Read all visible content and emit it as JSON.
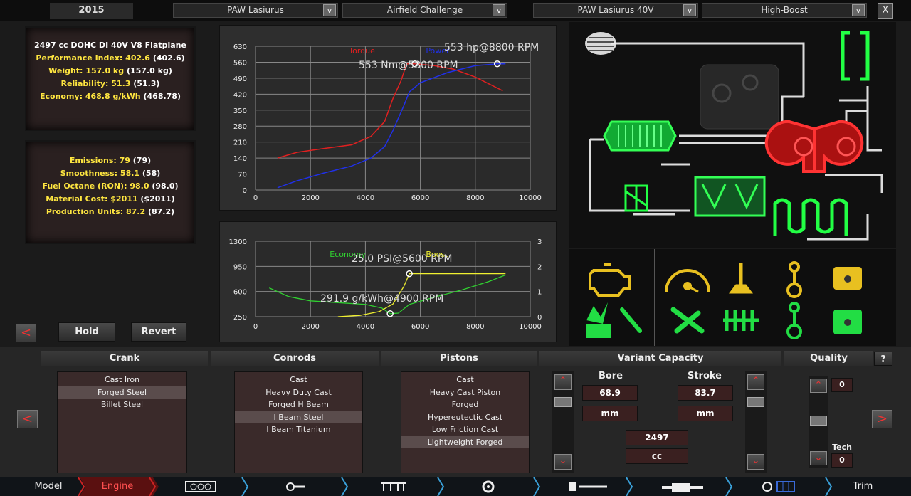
{
  "top": {
    "year": "2015",
    "model": "PAW Lasiurus",
    "challenge": "Airfield Challenge",
    "engine": "PAW Lasiurus 40V",
    "variant": "High-Boost",
    "dropdown_glyph": "v",
    "close_glyph": "X"
  },
  "stats1": {
    "engine_name": "2497 cc DOHC DI 40V V8 Flatplane",
    "lines": [
      {
        "label": "Performance Index:",
        "value": "402.6",
        "prev": "(402.6)"
      },
      {
        "label": "Weight:",
        "value": "157.0 kg",
        "prev": "(157.0 kg)"
      },
      {
        "label": "Reliability:",
        "value": "51.3",
        "prev": "(51.3)"
      },
      {
        "label": "Economy:",
        "value": "468.8 g/kWh",
        "prev": "(468.78)"
      }
    ]
  },
  "stats2": {
    "lines": [
      {
        "label": "Emissions:",
        "value": "79",
        "prev": "(79)"
      },
      {
        "label": "Smoothness:",
        "value": "58.1",
        "prev": "(58)"
      },
      {
        "label": "Fuel Octane (RON):",
        "value": "98.0",
        "prev": "(98.0)"
      },
      {
        "label": "Material Cost:",
        "value": "$2011",
        "prev": "($2011)"
      },
      {
        "label": "Production Units:",
        "value": "87.2",
        "prev": "(87.2)"
      }
    ]
  },
  "buttons": {
    "hold": "Hold",
    "revert": "Revert",
    "prev_glyph": "<",
    "next_glyph": ">"
  },
  "chart_data": [
    {
      "type": "line",
      "x_ticks": [
        0,
        2000,
        4000,
        6000,
        8000,
        10000
      ],
      "y_ticks": [
        0,
        70,
        140,
        210,
        280,
        350,
        420,
        490,
        560,
        630
      ],
      "xlim": [
        0,
        10000
      ],
      "ylim": [
        0,
        630
      ],
      "grid": true,
      "series": [
        {
          "name": "Torque",
          "color": "#e02020",
          "x": [
            800,
            1500,
            2500,
            3500,
            4200,
            4700,
            5000,
            5300,
            5500,
            5800,
            6500,
            7200,
            8000,
            8500,
            9000
          ],
          "y": [
            140,
            165,
            182,
            198,
            235,
            300,
            400,
            480,
            553,
            553,
            545,
            530,
            495,
            465,
            435
          ]
        },
        {
          "name": "Power",
          "color": "#2030e8",
          "x": [
            800,
            1500,
            2500,
            3500,
            4200,
            4700,
            5000,
            5400,
            5600,
            6000,
            7000,
            8000,
            8800,
            9100
          ],
          "y": [
            10,
            40,
            75,
            105,
            140,
            190,
            260,
            370,
            430,
            470,
            515,
            545,
            553,
            553
          ]
        }
      ],
      "annotations": [
        "553 hp@8800 RPM",
        "553 Nm@5800 RPM"
      ],
      "markers": [
        {
          "x": 5800,
          "y": 553
        },
        {
          "x": 8800,
          "y": 553
        }
      ]
    },
    {
      "type": "line",
      "x_ticks": [
        0,
        2000,
        4000,
        6000,
        8000,
        10000
      ],
      "y_ticks_left": [
        250,
        600,
        950,
        1300
      ],
      "y_ticks_right": [
        0,
        1,
        2,
        3
      ],
      "xlim": [
        0,
        10000
      ],
      "ylim_left": [
        250,
        1300
      ],
      "ylim_right": [
        0,
        3
      ],
      "grid": true,
      "series": [
        {
          "name": "Economy",
          "color": "#30d030",
          "axis": "left",
          "x": [
            500,
            1200,
            2000,
            3000,
            4000,
            4600,
            4900,
            5200,
            5600,
            6500,
            7500,
            8500,
            9100
          ],
          "y": [
            650,
            530,
            470,
            445,
            420,
            370,
            292,
            300,
            420,
            520,
            620,
            740,
            830
          ]
        },
        {
          "name": "Boost",
          "color": "#f0f030",
          "axis": "right",
          "x": [
            3000,
            3800,
            4500,
            5000,
            5400,
            5600,
            6500,
            8000,
            9100
          ],
          "y": [
            0,
            0.05,
            0.2,
            0.5,
            1.2,
            1.71,
            1.71,
            1.71,
            1.71
          ]
        }
      ],
      "annotations": [
        "25.0 PSI@5600 RPM",
        "291.9 g/kWh@4900 RPM"
      ],
      "markers": [
        {
          "x": 4900,
          "y": 292
        },
        {
          "x": 5600,
          "y": 1.71
        }
      ]
    }
  ],
  "crank": {
    "title": "Crank",
    "items": [
      "Cast Iron",
      "Forged Steel",
      "Billet Steel"
    ],
    "selected": 1
  },
  "conrods": {
    "title": "Conrods",
    "items": [
      "Cast",
      "Heavy Duty Cast",
      "Forged H Beam",
      "I Beam Steel",
      "I Beam Titanium"
    ],
    "selected": 3
  },
  "pistons": {
    "title": "Pistons",
    "items": [
      "Cast",
      "Heavy Cast Piston",
      "Forged",
      "Hypereutectic Cast",
      "Low Friction Cast",
      "Lightweight Forged"
    ],
    "selected": 5
  },
  "capacity": {
    "title": "Variant Capacity",
    "bore_label": "Bore",
    "bore_value": "68.9",
    "bore_unit": "mm",
    "stroke_label": "Stroke",
    "stroke_value": "83.7",
    "stroke_unit": "mm",
    "displacement_value": "2497",
    "displacement_unit": "cc"
  },
  "quality": {
    "title": "Quality",
    "help": "?",
    "value": "0",
    "tech_label": "Tech",
    "tech_value": "0"
  },
  "nav": {
    "items": [
      "Model",
      "Engine",
      "Trim"
    ],
    "active": "Engine"
  },
  "colors": {
    "accent_yellow": "#ffe640",
    "status_green": "#30e030",
    "status_red": "#e02020",
    "nav_active": "#e03030"
  },
  "icons": [
    "engine-warning-icon",
    "boost-gauge-icon",
    "valve-icon",
    "conrod-icon",
    "piston-icon",
    "ignition-icon",
    "injector-icon",
    "tools-icon",
    "camshaft-icon",
    "crank-conrod-icon",
    "piston-green-icon",
    "air-filter-icon",
    "intercooler-icon",
    "turbo-icon",
    "throttle-icon",
    "intake-manifold-icon",
    "exhaust-icon"
  ]
}
